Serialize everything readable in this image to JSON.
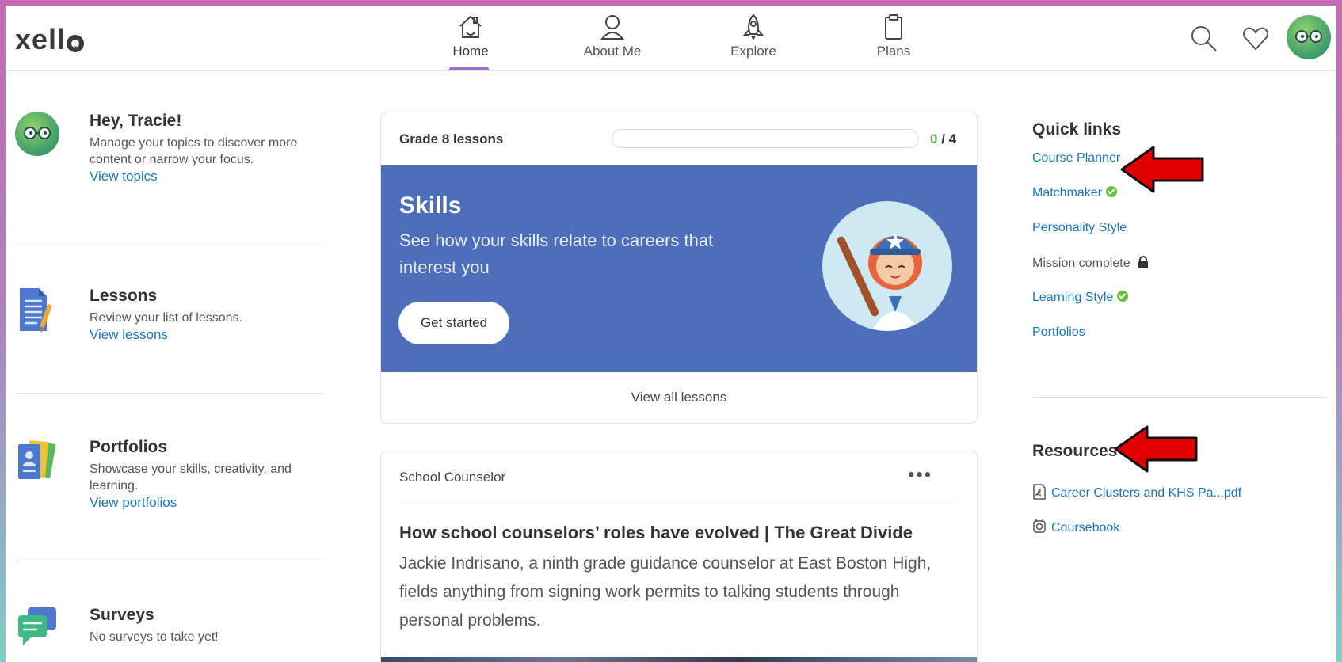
{
  "brand": {
    "logo_text": "xell"
  },
  "nav": {
    "home": "Home",
    "about": "About Me",
    "explore": "Explore",
    "plans": "Plans"
  },
  "sidebar": {
    "greeting": {
      "title": "Hey, Tracie!",
      "description": "Manage your topics to discover more content or narrow your focus.",
      "link": "View topics"
    },
    "lessons": {
      "title": "Lessons",
      "description": "Review your list of lessons.",
      "link": "View lessons"
    },
    "portfolios": {
      "title": "Portfolios",
      "description": "Showcase your skills, creativity, and learning.",
      "link": "View portfolios"
    },
    "surveys": {
      "title": "Surveys",
      "description": "No surveys to take yet!"
    }
  },
  "lessons_card": {
    "title": "Grade 8 lessons",
    "completed": "0",
    "total": "/ 4",
    "progress": 0,
    "skills_title": "Skills",
    "skills_subtitle": "See how your skills relate to careers that interest you",
    "get_started": "Get started",
    "view_all": "View all lessons"
  },
  "counselor_card": {
    "from": "School Counselor",
    "headline": "How school counselors’ roles have evolved | The Great Divide",
    "body": "Jackie Indrisano, a ninth grade guidance counselor at East Boston High, fields anything from signing work permits to talking students through personal problems."
  },
  "quick_links": {
    "heading": "Quick links",
    "items": [
      {
        "label": "Course Planner",
        "checked": false
      },
      {
        "label": "Matchmaker",
        "checked": true
      },
      {
        "label": "Personality Style",
        "checked": false
      },
      {
        "label": "Mission complete",
        "locked": true
      },
      {
        "label": "Learning Style",
        "checked": true
      },
      {
        "label": "Portfolios",
        "checked": false
      }
    ]
  },
  "resources": {
    "heading": "Resources",
    "items": [
      {
        "label": "Career Clusters and KHS Pa...pdf",
        "icon": "pdf-icon"
      },
      {
        "label": "Coursebook",
        "icon": "link-icon"
      }
    ]
  },
  "colors": {
    "accent_link": "#1779ba",
    "skills_banner": "#4d6eb8",
    "nav_active_underline": "#9b6bd6",
    "check_green": "#6cbf3a",
    "annotation_arrow": "#e00000"
  }
}
